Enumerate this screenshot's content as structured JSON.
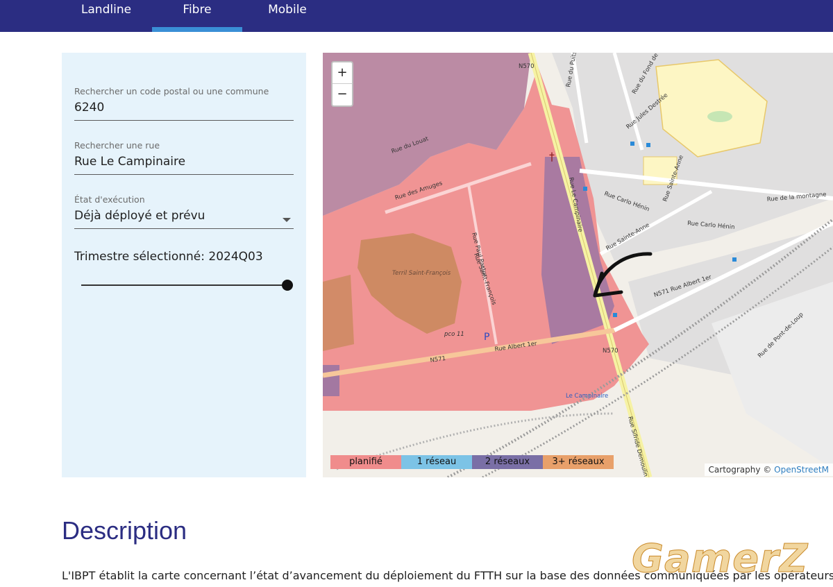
{
  "nav": {
    "tabs": [
      {
        "label": "Landline"
      },
      {
        "label": "Fibre",
        "active": true
      },
      {
        "label": "Mobile"
      }
    ],
    "accent": "#2b2d82",
    "active_underline": "#3a8fd6"
  },
  "panel": {
    "postal": {
      "label": "Rechercher un code postal ou une commune",
      "value": "6240"
    },
    "street": {
      "label": "Rechercher une rue",
      "value": "Rue Le Campinaire"
    },
    "status": {
      "label": "État d'exécution",
      "value": "Déjà déployé et prévu"
    },
    "quarter": {
      "text": "Trimestre sélectionné: 2024Q03",
      "slider_fraction": 1.0
    }
  },
  "map": {
    "zoom_in": "+",
    "zoom_out": "−",
    "labels": {
      "n570_top": "N570",
      "rue_du_puits": "Rue du Puits",
      "rue_du_fond": "Rue du Fond de la",
      "rue_jules": "Rue Jules Destrée",
      "rue_du_louat": "Rue du Louat",
      "rue_des_amuges": "Rue des Amuges",
      "rue_carlo_henin": "Rue Carlo Hénin",
      "rue_carlo_henin2": "Rue Carlo Hénin",
      "rue_sainte_anne": "Rue Sainte-Anne",
      "rue_sainte_anne2": "Rue Sainte-Anne",
      "rue_de_la_montagne": "Rue de la montagne",
      "rue_paul_pastur": "Rue Paul Pastur",
      "rue_le_campinaire": "Rue Le Campinaire",
      "rue_saint_francois": "Rue Saint-François",
      "terril": "Terril Saint-François",
      "n571_rue_albert": "N571 Rue Albert 1er",
      "rue_albert_1er": "Rue Albert 1er",
      "n571": "N571",
      "n570": "N570",
      "le_campinaire": "Le Campinaire",
      "rue_sifride": "Rue Sifride Demoulin",
      "rue_de_pont": "Rue de Pont-de-Loup",
      "pco": "pco 11"
    },
    "legend": [
      {
        "label": "planifié",
        "color": "#f08c8c"
      },
      {
        "label": "1 réseau",
        "color": "#7cc3e6"
      },
      {
        "label": "2 réseaux",
        "color": "#7a6fa6"
      },
      {
        "label": "3+ réseaux",
        "color": "#e8a06a"
      }
    ],
    "attribution": {
      "text": "Cartography © ",
      "link": "OpenStreetM"
    }
  },
  "description": {
    "title": "Description",
    "text": "L'IBPT établit la carte concernant l’état d’avancement du déploiement du FTTH sur la base des données communiquées par les opérateurs"
  },
  "watermark": "GamerZ"
}
